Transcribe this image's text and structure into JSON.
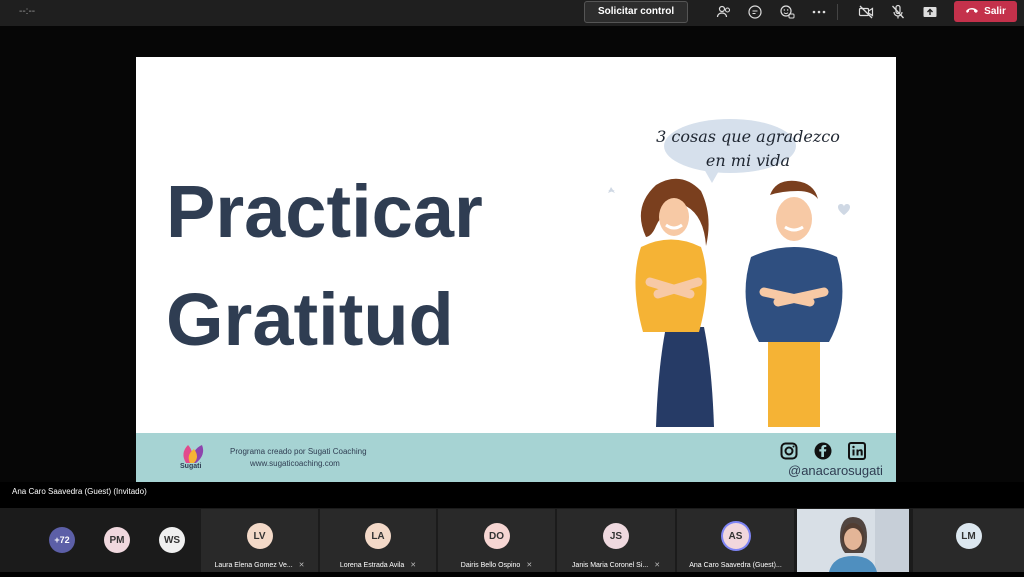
{
  "toolbar": {
    "timer": "--:--",
    "request_control_label": "Solicitar control",
    "leave_label": "Salir",
    "icons": [
      "people-icon",
      "chat-icon",
      "reactions-icon",
      "more-icon",
      "camera-off-icon",
      "mic-off-icon",
      "share-icon",
      "phone-icon"
    ]
  },
  "slide": {
    "title_line1": "Practicar",
    "title_line2": "Gratitud",
    "bubble_line1": "3 cosas que agradezco",
    "bubble_line2": "en mi vida",
    "logo_text": "Sugati",
    "program_text": "Programa creado por Sugati Coaching",
    "website": "www.sugaticoaching.com",
    "handle": "@anacarosugati",
    "colors": {
      "title": "#2f3d52",
      "footer": "#a6d3d3",
      "bubble": "#d6e0ec",
      "woman_sweater": "#f5b335",
      "man_sweater": "#2f4f80",
      "man_pants": "#f5b335",
      "woman_skirt": "#263b66"
    }
  },
  "presenter_label": "Ana Caro Saavedra (Guest) (Invitado)",
  "participants": {
    "overflow": "+72",
    "small_avatars": [
      {
        "initials": "PM",
        "color": "#f0d8de"
      },
      {
        "initials": "WS",
        "color": "#f0f0f0"
      }
    ],
    "tiles": [
      {
        "initials": "LV",
        "name": "Laura Elena Gomez Ve...",
        "color": "#f3d9c8"
      },
      {
        "initials": "LA",
        "name": "Lorena Estrada Avila",
        "color": "#f3d9c8"
      },
      {
        "initials": "DO",
        "name": "Dairis Bello Ospino",
        "color": "#f6d6d3"
      },
      {
        "initials": "JS",
        "name": "Janis Maria Coronel Si...",
        "color": "#efd9df"
      },
      {
        "initials": "AS",
        "name": "Ana Caro Saavedra (Guest)...",
        "color": "#f1d7dd"
      },
      {
        "initials": "LM",
        "name": "",
        "color": "#dce7ef"
      }
    ]
  }
}
